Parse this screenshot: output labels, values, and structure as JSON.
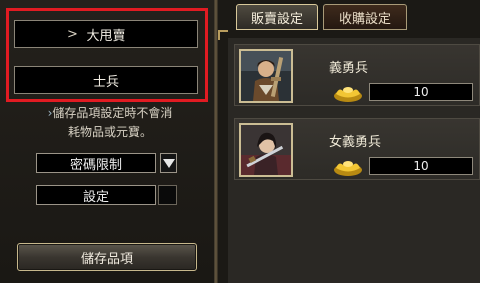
{
  "sidebar": {
    "field_primary": {
      "arrow": ">",
      "label": "大甩賣"
    },
    "field_secondary": {
      "label": "士兵"
    },
    "note": {
      "bullet": "›",
      "line1": "儲存品項設定時不會消",
      "line2": "耗物品或元寶。"
    },
    "password_select": {
      "value": "密碼限制",
      "dropdown_icon": "triangle-down-icon"
    },
    "settings_label": "設定",
    "save_button_label": "儲存品項"
  },
  "tabs": [
    {
      "label": "販賣設定",
      "active": true
    },
    {
      "label": "收購設定",
      "active": false
    }
  ],
  "items": [
    {
      "name": "義勇兵",
      "price": "10",
      "currency_icon": "gold-ingot-icon",
      "portrait": "militia-portrait"
    },
    {
      "name": "女義勇兵",
      "price": "10",
      "currency_icon": "gold-ingot-icon",
      "portrait": "female-militia-portrait"
    }
  ],
  "colors": {
    "highlight_frame": "#e11b22",
    "gold_border": "#cbbd94",
    "panel_bg": "#1b1915",
    "field_bg": "#000000"
  }
}
